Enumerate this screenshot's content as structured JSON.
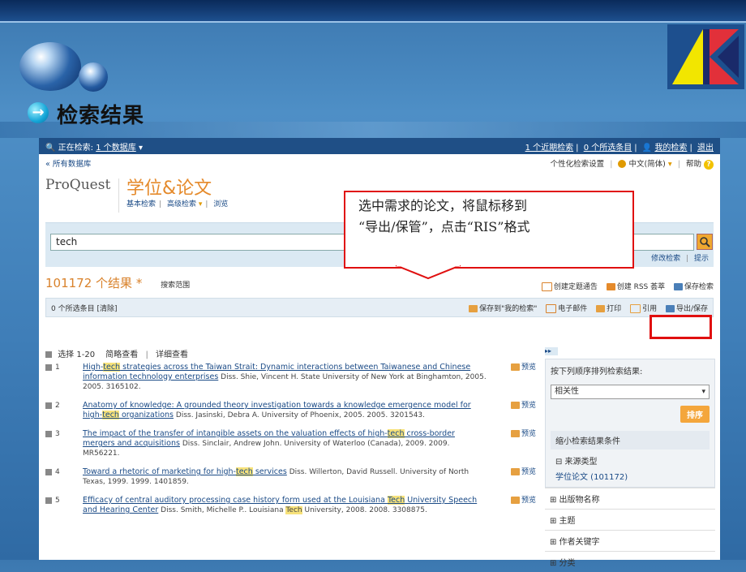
{
  "slide": {
    "title": "检索结果"
  },
  "nav": {
    "left_prefix": "正在检索:",
    "db_link": "1 个数据库",
    "links": [
      "1 个近期检索",
      "0 个所选条目",
      "我的检索",
      "退出"
    ]
  },
  "topbar": {
    "all_db": "« 所有数据库",
    "personal": "个性化检索设置",
    "lang": "中文(简体)",
    "help": "帮助"
  },
  "brand": {
    "proquest": "ProQuest",
    "product": "学位&论文",
    "basic": "基本检索",
    "advanced": "高级检索",
    "browse": "浏览"
  },
  "search": {
    "value": "tech",
    "modify": "修改检索",
    "tips": "提示"
  },
  "results": {
    "count": "101172 个结果",
    "asterisk": "*",
    "scope": "搜索范围",
    "alert": "创建定题通告",
    "rss": "创建 RSS 荟萃",
    "save_search": "保存检索"
  },
  "selbar": {
    "selected": "0 个所选条目 [清除]",
    "save_mine": "保存到\"我的检索\"",
    "email": "电子邮件",
    "print": "打印",
    "cite": "引用",
    "export": "导出/保存"
  },
  "view": {
    "select": "选择 1-20",
    "brief": "简略查看",
    "detail": "详细查看"
  },
  "items": [
    {
      "num": "1",
      "t1": "High-",
      "hl": "tech",
      "t2": " strategies across the Taiwan Strait: Dynamic interactions between Taiwanese and Chinese information technology enterprises",
      "meta": "Diss. Shie, Vincent H. State University of New York at Binghamton, 2005. 2005. 3165102."
    },
    {
      "num": "2",
      "t1": "Anatomy of knowledge: A grounded theory investigation towards a knowledge emergence model for high-",
      "hl": "tech",
      "t2": " organizations",
      "meta": "Diss. Jasinski, Debra A. University of Phoenix, 2005. 2005. 3201543."
    },
    {
      "num": "3",
      "t1": "The impact of the transfer of intangible assets on the valuation effects of high-",
      "hl": "tech",
      "t2": " cross-border mergers and acquisitions",
      "meta": "Diss. Sinclair, Andrew John. University of Waterloo (Canada), 2009. 2009. MR56221."
    },
    {
      "num": "4",
      "t1": "Toward a rhetoric of marketing for high-",
      "hl": "tech",
      "t2": " services",
      "meta": "Diss. Willerton, David Russell. University of North Texas, 1999. 1999. 1401859."
    },
    {
      "num": "5",
      "t1": "Efficacy of central auditory processing case history form used at the Louisiana ",
      "hl": "Tech",
      "t2": " University Speech and Hearing Center",
      "meta1": "Diss. Smith, Michelle P.. Louisiana ",
      "meta_hl": "Tech",
      "meta2": " University, 2008. 2008. 3308875."
    }
  ],
  "preview_label": "预览",
  "side": {
    "toggle": "▸▸",
    "sort_title": "按下列顺序排列检索结果:",
    "sort_value": "相关性",
    "sort_btn": "排序",
    "narrow_title": "缩小检索结果条件",
    "facet_source": "⊟ 来源类型",
    "facet_source_val": "学位论文 (101172)",
    "facets": [
      "⊞ 出版物名称",
      "⊞ 主题",
      "⊞ 作者关键字",
      "⊞ 分类"
    ]
  },
  "callout": {
    "line1": "选中需求的论文，将鼠标移到",
    "line2": "“导出/保管”，点击“RIS”格式"
  },
  "colors": {
    "accent": "#e58a2b",
    "link": "#1a4a86",
    "highlight": "#f7e27a",
    "callout_border": "#e01010"
  }
}
